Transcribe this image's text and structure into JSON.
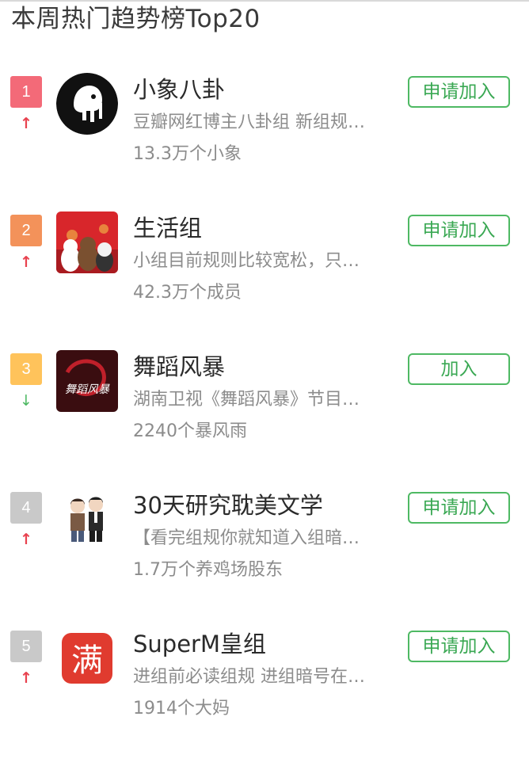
{
  "page": {
    "title": "本周热门趋势榜Top20"
  },
  "colors": {
    "rank1": "#f36a78",
    "rank2": "#f3925a",
    "rank3": "#ffc35b",
    "rank_other": "#c9c9c9",
    "trend_up": "#e8424f",
    "trend_down": "#4eb963",
    "button_green": "#4eb963"
  },
  "groups": [
    {
      "rank": "1",
      "trend": "↑",
      "trend_icon": "arrow-up-icon",
      "name": "小象八卦",
      "description": "豆瓣网红博主八卦组 新组规…",
      "members": "13.3万个小象",
      "button": "申请加入",
      "avatar_icon": "elephant-logo"
    },
    {
      "rank": "2",
      "trend": "↑",
      "trend_icon": "arrow-up-icon",
      "name": "生活组",
      "description": "小组目前规则比较宽松，只…",
      "members": "42.3万个成员",
      "button": "申请加入",
      "avatar_icon": "bears-image"
    },
    {
      "rank": "3",
      "trend": "↓",
      "trend_icon": "arrow-down-icon",
      "name": "舞蹈风暴",
      "description": "湖南卫视《舞蹈风暴》节目…",
      "members": "2240个暴风雨",
      "button": "加入",
      "avatar_icon": "dance-storm-logo",
      "avatar_text": "舞蹈风暴"
    },
    {
      "rank": "4",
      "trend": "↑",
      "trend_icon": "arrow-up-icon",
      "name": "30天研究耽美文学",
      "description": "【看完组规你就知道入组暗…",
      "members": "1.7万个养鸡场股东",
      "button": "申请加入",
      "avatar_icon": "two-men-illustration"
    },
    {
      "rank": "5",
      "trend": "↑",
      "trend_icon": "arrow-up-icon",
      "name": "SuperM皇组",
      "description": "进组前必读组规 进组暗号在…",
      "members": "1914个大妈",
      "button": "申请加入",
      "avatar_icon": "man-character-icon",
      "avatar_text": "满"
    }
  ]
}
